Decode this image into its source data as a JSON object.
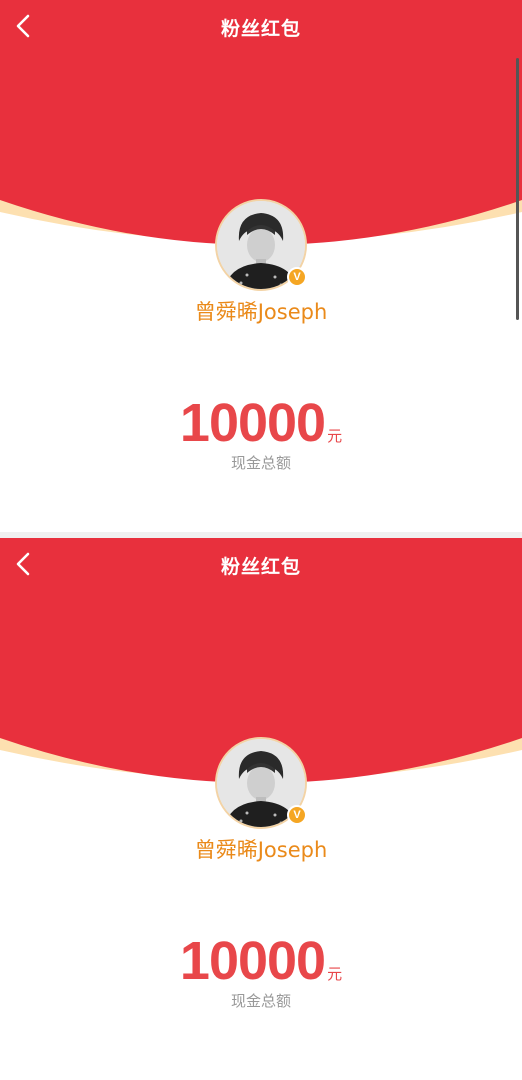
{
  "screens": [
    {
      "nav": {
        "title": "粉丝红包",
        "back_icon": "chevron-left-icon"
      },
      "sender": {
        "name": "曾舜晞Joseph",
        "verified_badge": "V"
      },
      "amount": {
        "value": "10000",
        "unit": "元",
        "label": "现金总额"
      }
    },
    {
      "nav": {
        "title": "粉丝红包",
        "back_icon": "chevron-left-icon"
      },
      "sender": {
        "name": "曾舜晞Joseph",
        "verified_badge": "V"
      },
      "amount": {
        "value": "10000",
        "unit": "元",
        "label": "现金总额"
      }
    }
  ],
  "colors": {
    "red": "#e8303d",
    "gold_rim": "#fde0b0",
    "name_orange": "#ea8a1a",
    "amount_red": "#e8474a",
    "label_gray": "#999999",
    "badge_orange": "#f5a623"
  }
}
